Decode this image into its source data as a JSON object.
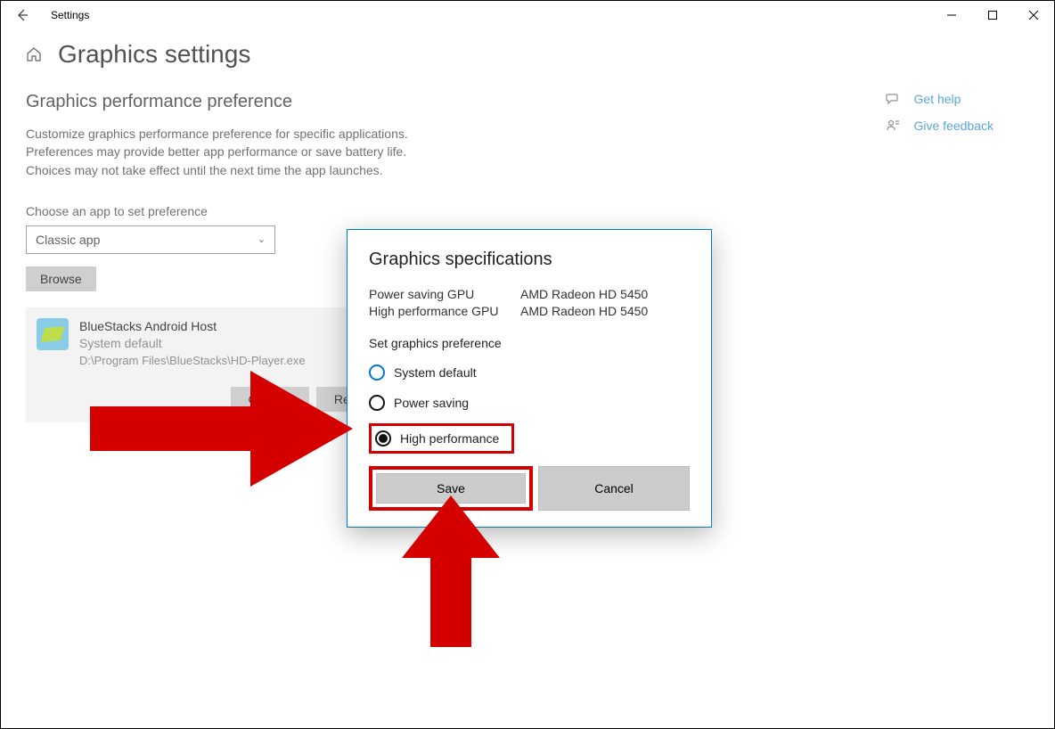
{
  "window": {
    "title": "Settings"
  },
  "page": {
    "title": "Graphics settings"
  },
  "section": {
    "heading": "Graphics performance preference",
    "description": "Customize graphics performance preference for specific applications. Preferences may provide better app performance or save battery life. Choices may not take effect until the next time the app launches.",
    "choose_label": "Choose an app to set preference",
    "select_value": "Classic app",
    "browse_label": "Browse"
  },
  "app": {
    "name": "BlueStacks Android Host",
    "pref": "System default",
    "path": "D:\\Program Files\\BlueStacks\\HD-Player.exe",
    "options_btn": "Options",
    "remove_btn": "Remove"
  },
  "help": {
    "get_help": "Get help",
    "give_feedback": "Give feedback"
  },
  "dialog": {
    "title": "Graphics specifications",
    "gpu_rows": [
      {
        "label": "Power saving GPU",
        "value": "AMD Radeon HD 5450"
      },
      {
        "label": "High performance GPU",
        "value": "AMD Radeon HD 5450"
      }
    ],
    "pref_label": "Set graphics preference",
    "options": {
      "system_default": "System default",
      "power_saving": "Power saving",
      "high_performance": "High performance"
    },
    "save": "Save",
    "cancel": "Cancel"
  }
}
